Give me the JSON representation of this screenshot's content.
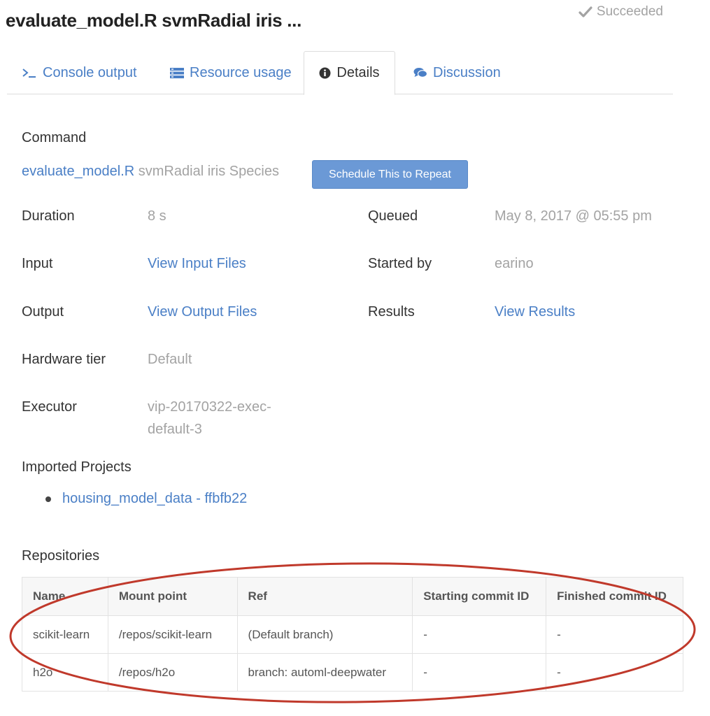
{
  "header": {
    "title": "evaluate_model.R svmRadial iris ...",
    "status": "Succeeded"
  },
  "tabs": [
    {
      "label": "Console output",
      "icon": "terminal-icon"
    },
    {
      "label": "Resource usage",
      "icon": "server-icon"
    },
    {
      "label": "Details",
      "icon": "info-icon",
      "active": true
    },
    {
      "label": "Discussion",
      "icon": "comments-icon"
    }
  ],
  "details": {
    "command_label": "Command",
    "command_script": "evaluate_model.R",
    "command_args": " svmRadial iris Species",
    "schedule_button": "Schedule This to Repeat",
    "duration_label": "Duration",
    "duration_value": "8 s",
    "queued_label": "Queued",
    "queued_value": "May 8, 2017 @ 05:55 pm",
    "input_label": "Input",
    "input_link": "View Input Files",
    "started_by_label": "Started by",
    "started_by_value": "earino",
    "output_label": "Output",
    "output_link": "View Output Files",
    "results_label": "Results",
    "results_link": "View Results",
    "hardware_label": "Hardware tier",
    "hardware_value": "Default",
    "executor_label": "Executor",
    "executor_line1": "vip-20170322-exec-",
    "executor_line2": "default-3",
    "imported_label": "Imported Projects",
    "imported_projects": [
      "housing_model_data - ffbfb22"
    ]
  },
  "repositories": {
    "label": "Repositories",
    "columns": [
      "Name",
      "Mount point",
      "Ref",
      "Starting commit ID",
      "Finished commit ID"
    ],
    "rows": [
      [
        "scikit-learn",
        "/repos/scikit-learn",
        "(Default branch)",
        "-",
        "-"
      ],
      [
        "h2o",
        "/repos/h2o",
        "branch: automl-deepwater",
        "-",
        "-"
      ]
    ]
  },
  "colors": {
    "link": "#4a7fc6",
    "muted": "#a3a3a3",
    "button": "#6b99d6",
    "annotation": "#c0392b"
  }
}
